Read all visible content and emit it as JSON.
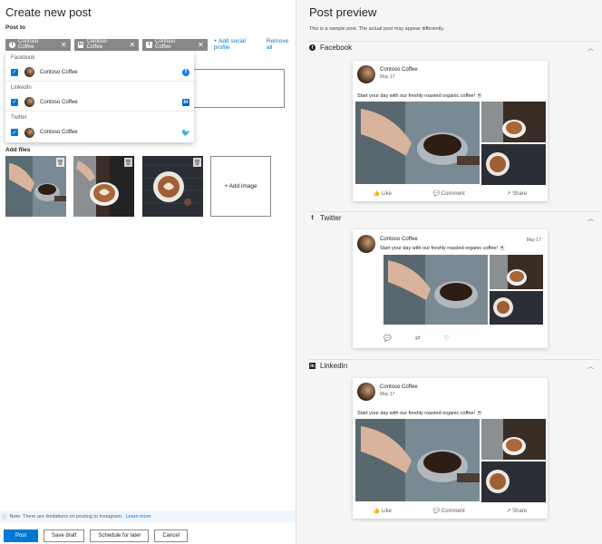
{
  "left": {
    "title": "Create new post",
    "post_to_label": "Post to",
    "chips": [
      {
        "network": "facebook",
        "icon": "f",
        "label": "Contoso Coffee"
      },
      {
        "network": "linkedin",
        "icon": "in",
        "label": "Contoso Coffee"
      },
      {
        "network": "twitter",
        "icon": "t",
        "label": "Contoso Coffee"
      }
    ],
    "add_social_profile": "Add social profile",
    "remove_all": "Remove all",
    "dropdown": {
      "groups": [
        {
          "name": "Facebook",
          "account": "Contoso Coffee",
          "checked": true
        },
        {
          "name": "LinkedIn",
          "account": "Contoso Coffee",
          "checked": true
        },
        {
          "name": "Twitter",
          "account": "Contoso Coffee",
          "checked": true
        }
      ]
    },
    "add_files_label": "Add files",
    "add_image_label": "+ Add image",
    "note_text": "Note: There are limitations on posting to Instagram.",
    "note_link": "Learn more",
    "buttons": {
      "post": "Post",
      "save_draft": "Save draft",
      "schedule": "Schedule for later",
      "cancel": "Cancel"
    }
  },
  "preview": {
    "title": "Post preview",
    "subtitle": "This is a sample post. The actual post may appear differently.",
    "sections": [
      {
        "network": "Facebook",
        "icon": "f"
      },
      {
        "network": "Twitter",
        "icon": "t"
      },
      {
        "network": "LinkedIn",
        "icon": "in"
      }
    ],
    "account_name": "Contoso Coffee",
    "date": "May 17",
    "twitter_date": "May 17",
    "post_text": "Start your day with our freshly roasted organic coffee! ☕",
    "actions": {
      "like": "Like",
      "comment": "Comment",
      "share": "Share"
    }
  },
  "colors": {
    "accent": "#0078d4",
    "chip_bg": "#8a8886",
    "preview_bg": "#f5f5f5"
  }
}
